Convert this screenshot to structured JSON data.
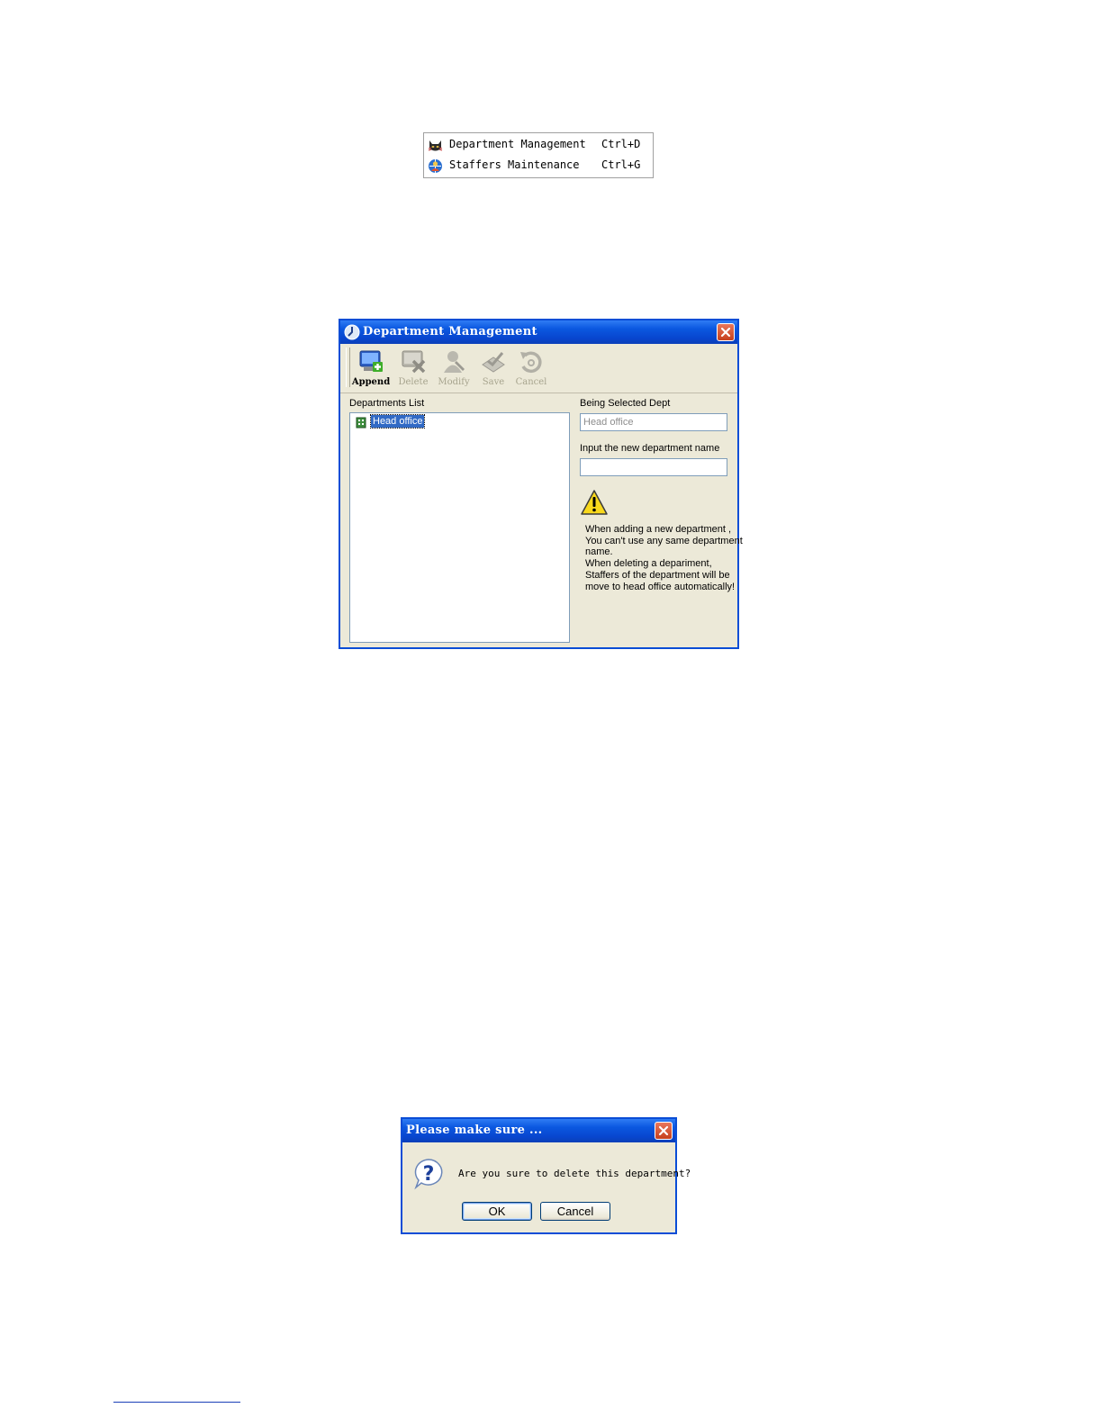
{
  "context_menu": {
    "items": [
      {
        "label": "Department Management",
        "shortcut": "Ctrl+D",
        "icon": "cat-face-icon"
      },
      {
        "label": "Staffers Maintenance",
        "shortcut": "Ctrl+G",
        "icon": "staff-globe-icon"
      }
    ]
  },
  "dept_window": {
    "title": "Department Management",
    "toolbar": {
      "append": "Append",
      "delete": "Delete",
      "modify": "Modify",
      "save": "Save",
      "cancel": "Cancel"
    },
    "departments_list_label": "Departments List",
    "departments": [
      "Head office"
    ],
    "being_selected_label": "Being Selected Dept",
    "being_selected_value": "Head office",
    "new_name_label": "Input the new department name",
    "new_name_value": "",
    "note_lines": [
      "When adding a new department ,",
      "You can't use any same department",
      "name.",
      "When deleting a depariment,",
      "Staffers of the department will be",
      "move to head office automatically!"
    ]
  },
  "confirm_dialog": {
    "title": "Please make sure ...",
    "message": "Are you sure to delete this department?",
    "ok_label": "OK",
    "cancel_label": "Cancel"
  },
  "colors": {
    "title_bar": "#0a4dd6",
    "dialog_face": "#ece9d8",
    "selection": "#316ac5",
    "close_button": "#d4532f"
  }
}
